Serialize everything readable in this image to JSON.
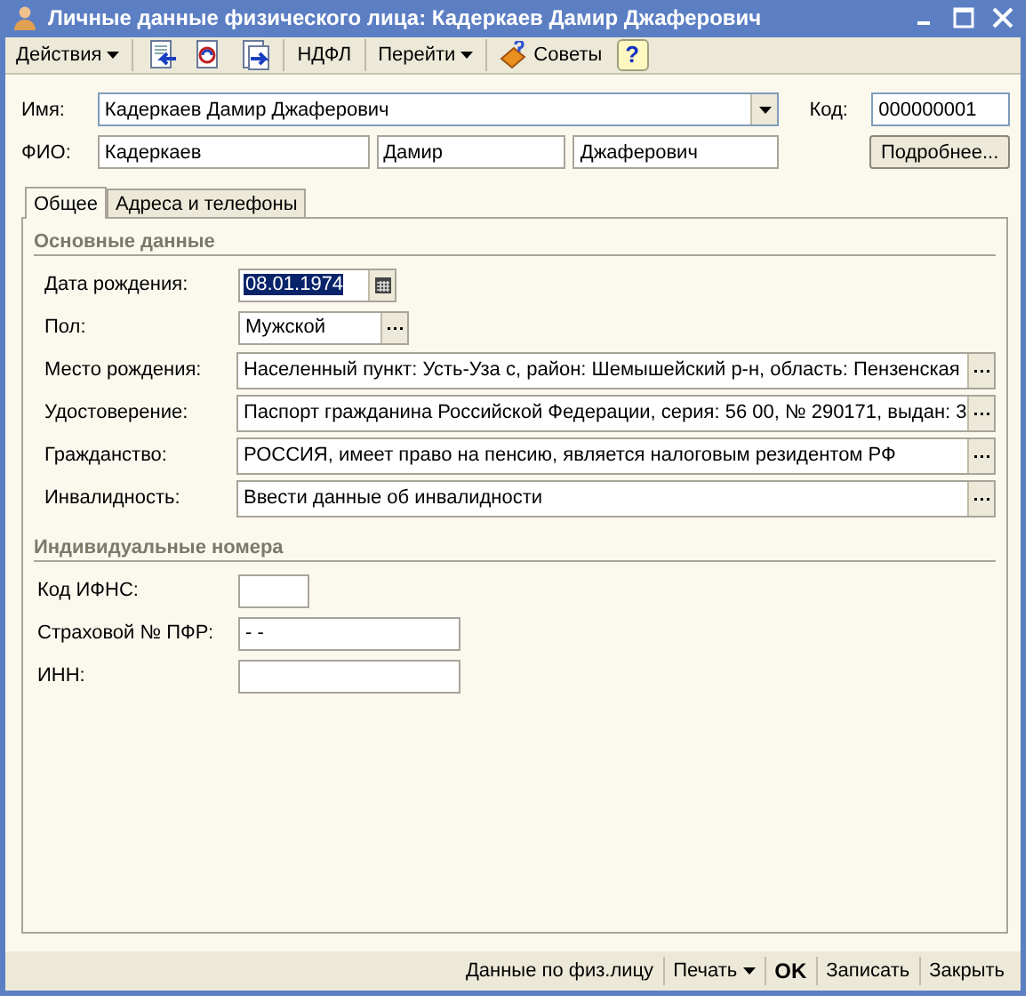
{
  "window": {
    "title": "Личные данные физического лица: Кадеркаев Дамир Джаферович"
  },
  "toolbar": [
    {
      "kind": "menu",
      "label": "Действия",
      "sep_before": false
    },
    {
      "kind": "icon",
      "sep_before": true
    },
    {
      "kind": "icon",
      "sep_before": false
    },
    {
      "kind": "icon",
      "sep_before": false
    },
    {
      "kind": "text",
      "label": "НДФЛ",
      "sep_before": true
    },
    {
      "kind": "menu",
      "label": "Перейти",
      "sep_before": true
    },
    {
      "kind": "tips",
      "label": "Советы",
      "sep_before": true
    },
    {
      "kind": "help",
      "label": "?",
      "sep_before": false
    }
  ],
  "header": {
    "name_label": "Имя:",
    "name_value": "Кадеркаев Дамир Джаферович",
    "code_label": "Код:",
    "code_value": "000000001",
    "fio_label": "ФИО:",
    "fio": [
      "Кадеркаев",
      "Дамир",
      "Джаферович"
    ],
    "details_button": "Подробнее..."
  },
  "tabs": [
    {
      "label": "Общее",
      "selected": true
    },
    {
      "label": "Адреса и телефоны",
      "selected": false
    }
  ],
  "sections": [
    {
      "title": "Основные данные",
      "rows": [
        {
          "kind": "date",
          "label": "Дата рождения:",
          "value": "08.01.1974",
          "selected": true
        },
        {
          "kind": "short",
          "label": "Пол:",
          "value": "Мужской"
        },
        {
          "kind": "wide",
          "label": "Место рождения:",
          "value": "Населенный пункт: Усть-Уза с, район:  Шемышейский р-н, область: Пензенская"
        },
        {
          "kind": "wide",
          "label": "Удостоверение:",
          "value": "Паспорт гражданина Российской Федерации, серия: 56 00, № 290171, выдан: 3"
        },
        {
          "kind": "wide",
          "label": "Гражданство:",
          "value": "РОССИЯ, имеет право на пенсию, является налоговым резидентом РФ"
        },
        {
          "kind": "wide",
          "label": "Инвалидность:",
          "value": "Ввести данные об инвалидности"
        }
      ]
    },
    {
      "title": "Индивидуальные номера",
      "rows": [
        {
          "kind": "small",
          "label": "Код ИФНС:"
        },
        {
          "kind": "medium",
          "label": "Страховой № ПФР:",
          "value": "-   -"
        },
        {
          "kind": "medium",
          "label": "ИНН:"
        }
      ]
    }
  ],
  "footer": [
    {
      "kind": "plain",
      "label": "Данные по физ.лицу"
    },
    {
      "kind": "menu",
      "label": "Печать"
    },
    {
      "kind": "default",
      "label": "OK"
    },
    {
      "kind": "plain",
      "label": "Записать"
    },
    {
      "kind": "plain",
      "label": "Закрыть"
    }
  ]
}
